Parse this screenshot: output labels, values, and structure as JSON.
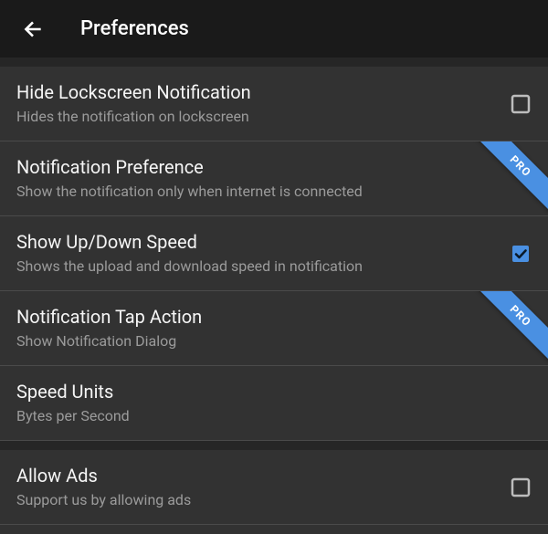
{
  "header": {
    "title": "Preferences"
  },
  "badges": {
    "pro": "PRO"
  },
  "colors": {
    "accent": "#4a90e2",
    "checkbox_border": "#bdbdbd"
  },
  "items": [
    {
      "title": "Hide Lockscreen Notification",
      "subtitle": "Hides the notification on lockscreen",
      "control": "checkbox",
      "checked": false,
      "pro": false,
      "section_start": true
    },
    {
      "title": "Notification Preference",
      "subtitle": "Show the notification only when internet is connected",
      "control": "none",
      "pro": true
    },
    {
      "title": "Show Up/Down Speed",
      "subtitle": "Shows the upload and download speed in notification",
      "control": "checkbox",
      "checked": true,
      "pro": false
    },
    {
      "title": "Notification Tap Action",
      "subtitle": "Show Notification Dialog",
      "control": "none",
      "pro": true
    },
    {
      "title": "Speed Units",
      "subtitle": "Bytes per Second",
      "control": "none",
      "pro": false
    },
    {
      "title": "Allow Ads",
      "subtitle": "Support us by allowing ads",
      "control": "checkbox",
      "checked": false,
      "pro": false,
      "section_start": true
    }
  ]
}
